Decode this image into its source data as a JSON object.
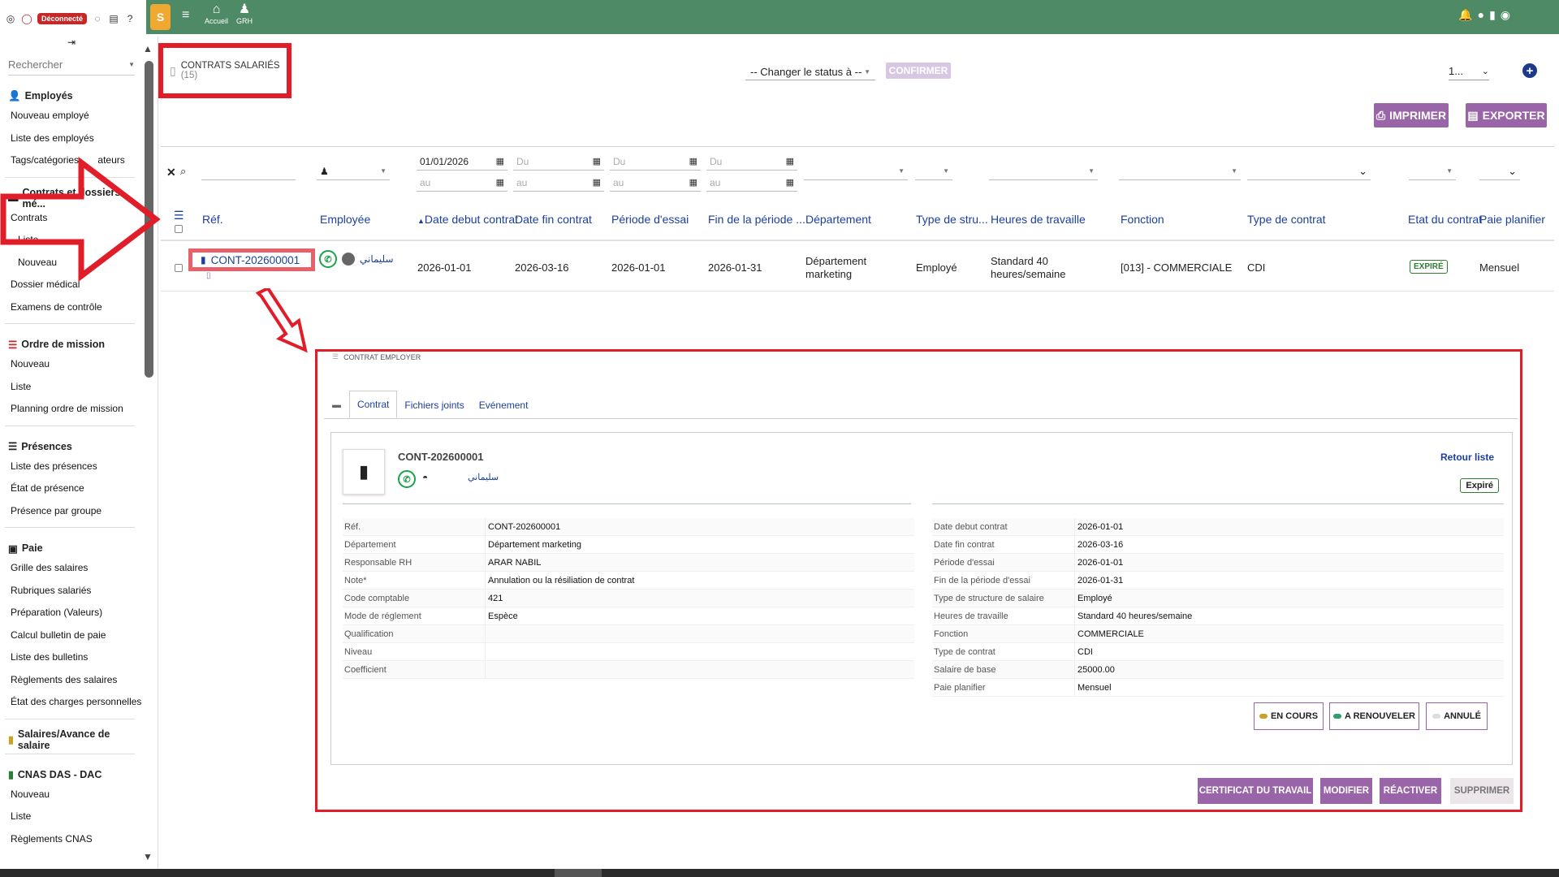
{
  "sidebar": {
    "disconnect": "Déconnecté",
    "search_placeholder": "Rechercher",
    "employes": {
      "title": "Employés",
      "items": [
        "Nouveau employé",
        "Liste des employés",
        "Tags/catégories",
        "ateurs"
      ]
    },
    "contrats": {
      "title": "Contrats et dossiers mé...",
      "items": [
        "Contrats",
        "Liste",
        "Nouveau",
        "Dossier médical",
        "Examens de contrôle"
      ]
    },
    "mission": {
      "title": "Ordre de mission",
      "items": [
        "Nouveau",
        "Liste",
        "Planning ordre de mission"
      ]
    },
    "presences": {
      "title": "Présences",
      "items": [
        "Liste des présences",
        "État de présence",
        "Présence par groupe"
      ]
    },
    "paie": {
      "title": "Paie",
      "items": [
        "Grille des salaires",
        "Rubriques salariés",
        "Préparation (Valeurs)",
        "Calcul bulletin de paie",
        "Liste des bulletins",
        "Règlements des salaires",
        "État des charges personnelles"
      ]
    },
    "salaires": {
      "title": "Salaires/Avance de salaire"
    },
    "cnas": {
      "title": "CNAS DAS - DAC",
      "items": [
        "Nouveau",
        "Liste",
        "Règlements CNAS"
      ]
    }
  },
  "topbar": {
    "logo": "S",
    "nav": [
      {
        "icon": "home-icon",
        "label": "Accueil"
      },
      {
        "icon": "user-icon",
        "label": "GRH"
      }
    ]
  },
  "header": {
    "title": "CONTRATS SALARIÉS",
    "count": "(15)",
    "status_select": "-- Changer le status à --",
    "confirm": "CONFIRMER",
    "page_select": "1...",
    "print": "IMPRIMER",
    "export": "EXPORTER"
  },
  "filters": {
    "date_debut_from": "01/01/2026",
    "du": "Du",
    "au": "au"
  },
  "table": {
    "headers": [
      "Réf.",
      "Employée",
      "Date debut contrat",
      "Date fin contrat",
      "Période d'essai",
      "Fin de la période ...",
      "Département",
      "Type de stru...",
      "Heures de travaille",
      "Fonction",
      "Type de contrat",
      "Etat du contrat",
      "Paie planifier"
    ],
    "rows": [
      {
        "ref": "CONT-202600001",
        "employee": "سليماني",
        "date_debut": "2026-01-01",
        "date_fin": "2026-03-16",
        "periode_essai": "2026-01-01",
        "fin_periode": "2026-01-31",
        "departement_1": "Département",
        "departement_2": "marketing",
        "type_structure": "Employé",
        "heures_1": "Standard 40",
        "heures_2": "heures/semaine",
        "fonction": "[013] - COMMERCIALE",
        "type_contrat": "CDI",
        "etat": "EXPIRÉ",
        "paie": "Mensuel"
      }
    ]
  },
  "modal": {
    "title": "CONTRAT EMPLOYER",
    "tabs": [
      "Contrat",
      "Fichiers joints",
      "Evénement"
    ],
    "ref": "CONT-202600001",
    "employee": "سليماني",
    "retour": "Retour liste",
    "etat": "Expiré",
    "left_fields": [
      {
        "k": "Réf.",
        "v": "CONT-202600001"
      },
      {
        "k": "Département",
        "v": "Département marketing"
      },
      {
        "k": "Responsable RH",
        "v": "ARAR NABIL"
      },
      {
        "k": "Note*",
        "v": "Annulation ou la résiliation de contrat"
      },
      {
        "k": "Code comptable",
        "v": "421"
      },
      {
        "k": "Mode de réglement",
        "v": "Espèce"
      },
      {
        "k": "Qualification",
        "v": ""
      },
      {
        "k": "Niveau",
        "v": ""
      },
      {
        "k": "Coefficient",
        "v": ""
      }
    ],
    "right_fields": [
      {
        "k": "Date debut contrat",
        "v": "2026-01-01"
      },
      {
        "k": "Date fin contrat",
        "v": "2026-03-16"
      },
      {
        "k": "Période d'essai",
        "v": "2026-01-01"
      },
      {
        "k": "Fin de la période d'essai",
        "v": "2026-01-31"
      },
      {
        "k": "Type de structure de salaire",
        "v": "Employé"
      },
      {
        "k": "Heures de travaille",
        "v": "Standard 40 heures/semaine"
      },
      {
        "k": "Fonction",
        "v": "COMMERCIALE"
      },
      {
        "k": "Type de contrat",
        "v": "CDI"
      },
      {
        "k": "Salaire de base",
        "v": "25000.00"
      },
      {
        "k": "Paie planifier",
        "v": "Mensuel"
      }
    ],
    "state_buttons": [
      {
        "label": "EN COURS",
        "color": "#c9a227"
      },
      {
        "label": "A RENOUVELER",
        "color": "#2e9e6a"
      },
      {
        "label": "ANNULÉ",
        "color": "#dddddd"
      }
    ],
    "actions": [
      "CERTIFICAT DU TRAVAIL",
      "MODIFIER",
      "RÉACTIVER",
      "SUPPRIMER"
    ]
  },
  "colors": {
    "topbar": "#4f8a66",
    "accent": "#9a65a8",
    "highlight": "#e11d2a",
    "link": "#1a3f9c"
  }
}
